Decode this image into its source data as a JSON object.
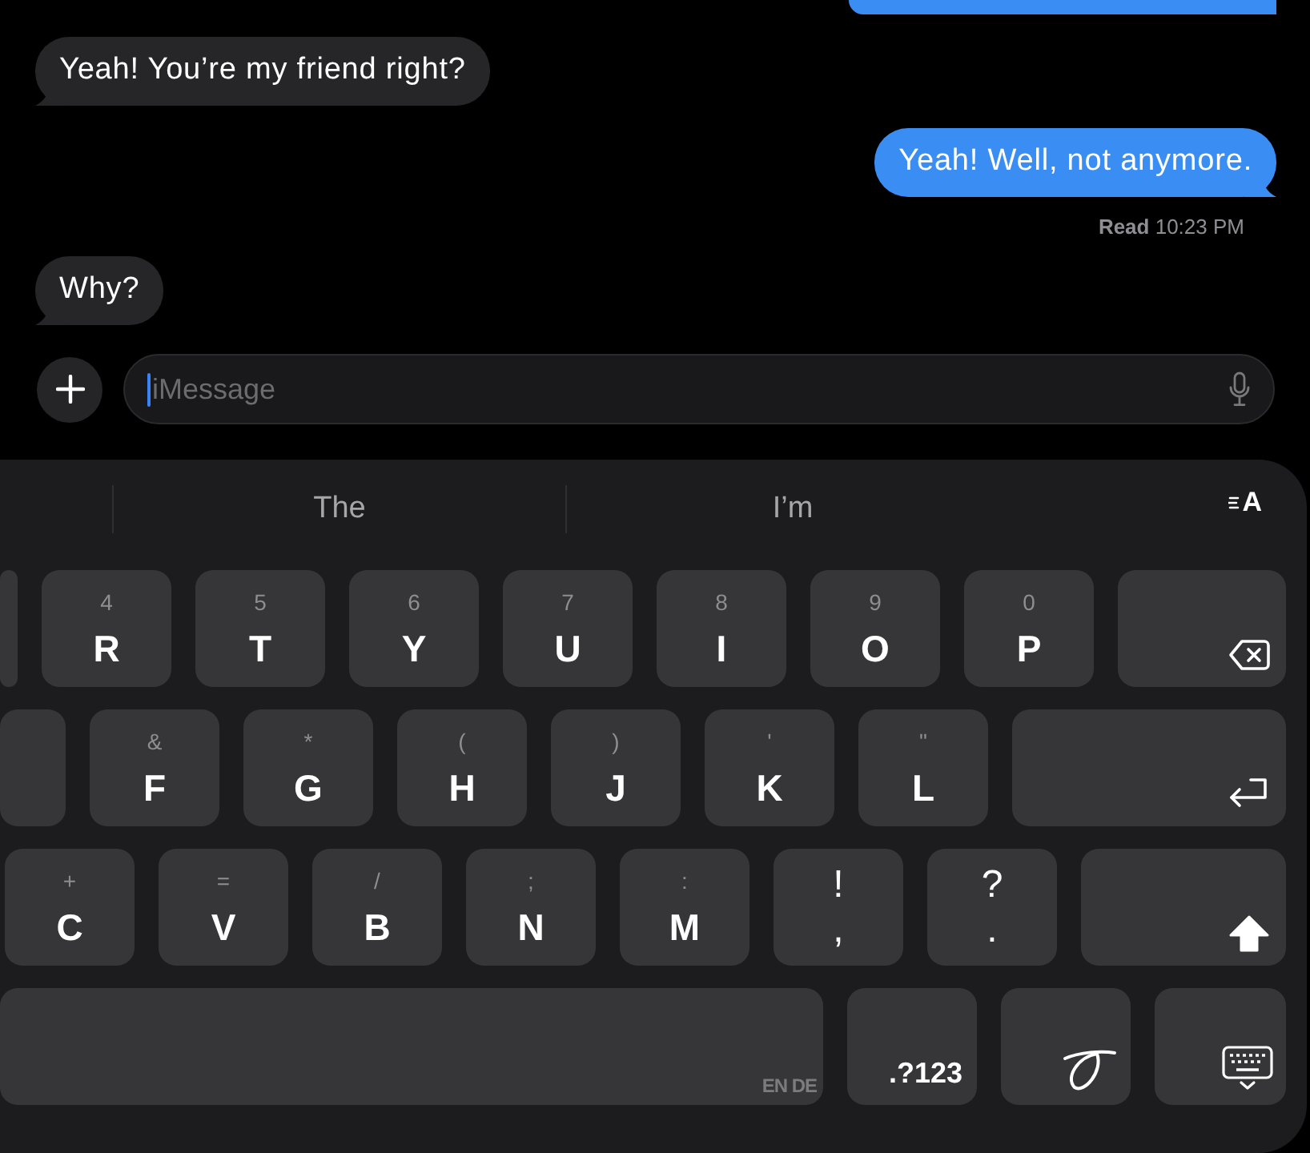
{
  "thread": {
    "messages": [
      {
        "kind": "sent",
        "cut_off": true
      },
      {
        "kind": "received",
        "cut_off": false,
        "text": "Yeah! You’re my friend right?"
      },
      {
        "kind": "sent",
        "cut_off": false,
        "text": "Yeah! Well, not anymore.",
        "receipt": "**Read** 10:23 PM"
      },
      {
        "kind": "received",
        "cut_off": false,
        "text": "Why?"
      }
    ]
  },
  "composer": {
    "placeholder": "iMessage",
    "focused": true
  },
  "keyboard": {
    "suggestions": [
      "The",
      "I’m"
    ],
    "format_button": {
      "label": "A"
    },
    "rows": [
      [
        {
          "kind": "cut"
        },
        {
          "kind": "letter",
          "char": "R",
          "alt": "4"
        },
        {
          "kind": "letter",
          "char": "T",
          "alt": "5"
        },
        {
          "kind": "letter",
          "char": "Y",
          "alt": "6"
        },
        {
          "kind": "letter",
          "char": "U",
          "alt": "7"
        },
        {
          "kind": "letter",
          "char": "I",
          "alt": "8"
        },
        {
          "kind": "letter",
          "char": "O",
          "alt": "9"
        },
        {
          "kind": "letter",
          "char": "P",
          "alt": "0"
        },
        {
          "kind": "backspace"
        }
      ],
      [
        {
          "kind": "cut"
        },
        {
          "kind": "letter",
          "char": "F",
          "alt": "&"
        },
        {
          "kind": "letter",
          "char": "G",
          "alt": "*"
        },
        {
          "kind": "letter",
          "char": "H",
          "alt": "("
        },
        {
          "kind": "letter",
          "char": "J",
          "alt": ")"
        },
        {
          "kind": "letter",
          "char": "K",
          "alt": "'"
        },
        {
          "kind": "letter",
          "char": "L",
          "alt": "\""
        },
        {
          "kind": "return"
        }
      ],
      [
        {
          "kind": "letter",
          "char": "C",
          "alt": "+"
        },
        {
          "kind": "letter",
          "char": "V",
          "alt": "="
        },
        {
          "kind": "letter",
          "char": "B",
          "alt": "/"
        },
        {
          "kind": "letter",
          "char": "N",
          "alt": ";"
        },
        {
          "kind": "letter",
          "char": "M",
          "alt": ":"
        },
        {
          "kind": "punct",
          "top": "!",
          "bottom": ","
        },
        {
          "kind": "punct",
          "top": "?",
          "bottom": "."
        },
        {
          "kind": "shift",
          "on": true
        }
      ],
      [
        {
          "kind": "space",
          "label": "EN DE"
        },
        {
          "kind": "symbols",
          "label": ".?123"
        },
        {
          "kind": "handwriting"
        },
        {
          "kind": "dismiss"
        }
      ]
    ]
  }
}
